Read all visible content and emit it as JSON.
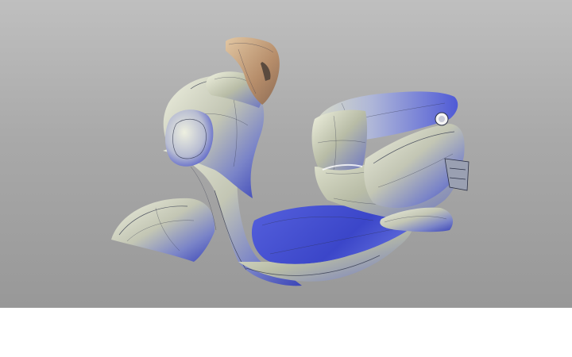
{
  "viewport": {
    "background_top": "#bfbfbf",
    "background_bottom": "#989898",
    "model": "scooter-surface-model"
  },
  "colors": {
    "surface_light": "#e9ecd9",
    "surface_mid": "#b9bdae",
    "surface_blue": "#4c56d8",
    "surface_deep_blue": "#2c37a8",
    "surface_highlight": "#ffffff",
    "grip_tan": "#c9a17b",
    "wire": "#2a2f45"
  },
  "footer": {
    "background": "#ffffff"
  }
}
